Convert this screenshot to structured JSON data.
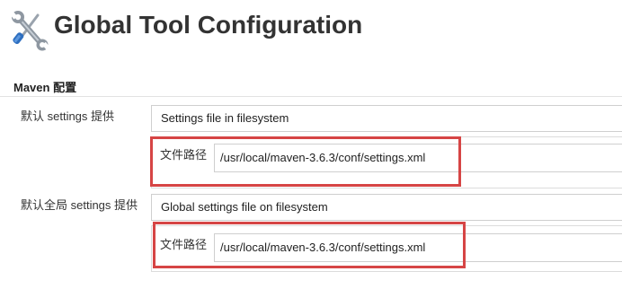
{
  "header": {
    "title": "Global Tool Configuration",
    "icon": "tools-icon"
  },
  "section": {
    "title": "Maven 配置"
  },
  "settings": {
    "default_settings": {
      "label": "默认 settings 提供",
      "selected": "Settings file in filesystem",
      "path_label": "文件路径",
      "path_value": "/usr/local/maven-3.6.3/conf/settings.xml"
    },
    "global_settings": {
      "label": "默认全局 settings 提供",
      "selected": "Global settings file on filesystem",
      "path_label": "文件路径",
      "path_value": "/usr/local/maven-3.6.3/conf/settings.xml"
    }
  },
  "colors": {
    "highlight": "#d64545"
  }
}
